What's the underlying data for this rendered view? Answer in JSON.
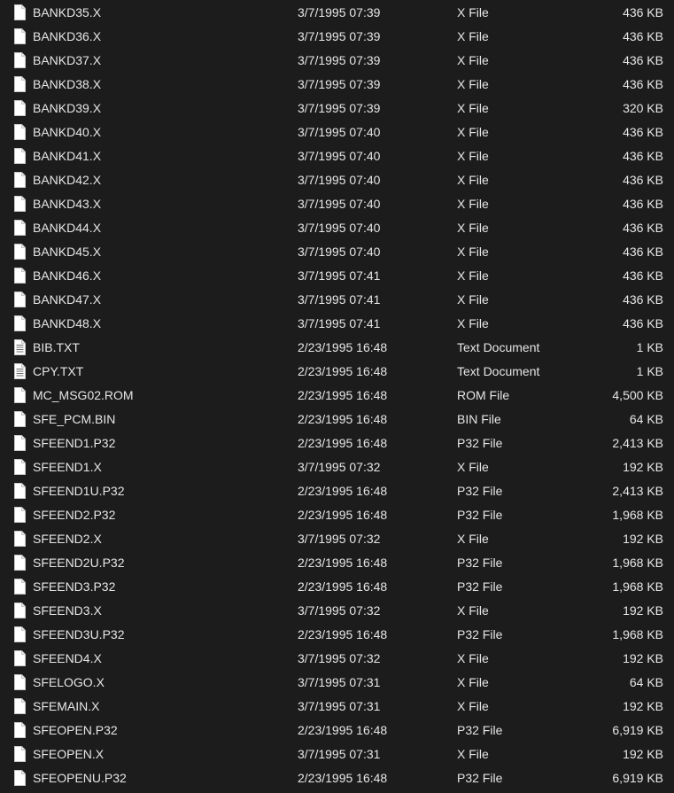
{
  "files": [
    {
      "name": "BANKD35.X",
      "date": "3/7/1995 07:39",
      "type": "X File",
      "size": "436 KB",
      "icon": "file-icon"
    },
    {
      "name": "BANKD36.X",
      "date": "3/7/1995 07:39",
      "type": "X File",
      "size": "436 KB",
      "icon": "file-icon"
    },
    {
      "name": "BANKD37.X",
      "date": "3/7/1995 07:39",
      "type": "X File",
      "size": "436 KB",
      "icon": "file-icon"
    },
    {
      "name": "BANKD38.X",
      "date": "3/7/1995 07:39",
      "type": "X File",
      "size": "436 KB",
      "icon": "file-icon"
    },
    {
      "name": "BANKD39.X",
      "date": "3/7/1995 07:39",
      "type": "X File",
      "size": "320 KB",
      "icon": "file-icon"
    },
    {
      "name": "BANKD40.X",
      "date": "3/7/1995 07:40",
      "type": "X File",
      "size": "436 KB",
      "icon": "file-icon"
    },
    {
      "name": "BANKD41.X",
      "date": "3/7/1995 07:40",
      "type": "X File",
      "size": "436 KB",
      "icon": "file-icon"
    },
    {
      "name": "BANKD42.X",
      "date": "3/7/1995 07:40",
      "type": "X File",
      "size": "436 KB",
      "icon": "file-icon"
    },
    {
      "name": "BANKD43.X",
      "date": "3/7/1995 07:40",
      "type": "X File",
      "size": "436 KB",
      "icon": "file-icon"
    },
    {
      "name": "BANKD44.X",
      "date": "3/7/1995 07:40",
      "type": "X File",
      "size": "436 KB",
      "icon": "file-icon"
    },
    {
      "name": "BANKD45.X",
      "date": "3/7/1995 07:40",
      "type": "X File",
      "size": "436 KB",
      "icon": "file-icon"
    },
    {
      "name": "BANKD46.X",
      "date": "3/7/1995 07:41",
      "type": "X File",
      "size": "436 KB",
      "icon": "file-icon"
    },
    {
      "name": "BANKD47.X",
      "date": "3/7/1995 07:41",
      "type": "X File",
      "size": "436 KB",
      "icon": "file-icon"
    },
    {
      "name": "BANKD48.X",
      "date": "3/7/1995 07:41",
      "type": "X File",
      "size": "436 KB",
      "icon": "file-icon"
    },
    {
      "name": "BIB.TXT",
      "date": "2/23/1995 16:48",
      "type": "Text Document",
      "size": "1 KB",
      "icon": "text-file-icon"
    },
    {
      "name": "CPY.TXT",
      "date": "2/23/1995 16:48",
      "type": "Text Document",
      "size": "1 KB",
      "icon": "text-file-icon"
    },
    {
      "name": "MC_MSG02.ROM",
      "date": "2/23/1995 16:48",
      "type": "ROM File",
      "size": "4,500 KB",
      "icon": "file-icon"
    },
    {
      "name": "SFE_PCM.BIN",
      "date": "2/23/1995 16:48",
      "type": "BIN File",
      "size": "64 KB",
      "icon": "file-icon"
    },
    {
      "name": "SFEEND1.P32",
      "date": "2/23/1995 16:48",
      "type": "P32 File",
      "size": "2,413 KB",
      "icon": "file-icon"
    },
    {
      "name": "SFEEND1.X",
      "date": "3/7/1995 07:32",
      "type": "X File",
      "size": "192 KB",
      "icon": "file-icon"
    },
    {
      "name": "SFEEND1U.P32",
      "date": "2/23/1995 16:48",
      "type": "P32 File",
      "size": "2,413 KB",
      "icon": "file-icon"
    },
    {
      "name": "SFEEND2.P32",
      "date": "2/23/1995 16:48",
      "type": "P32 File",
      "size": "1,968 KB",
      "icon": "file-icon"
    },
    {
      "name": "SFEEND2.X",
      "date": "3/7/1995 07:32",
      "type": "X File",
      "size": "192 KB",
      "icon": "file-icon"
    },
    {
      "name": "SFEEND2U.P32",
      "date": "2/23/1995 16:48",
      "type": "P32 File",
      "size": "1,968 KB",
      "icon": "file-icon"
    },
    {
      "name": "SFEEND3.P32",
      "date": "2/23/1995 16:48",
      "type": "P32 File",
      "size": "1,968 KB",
      "icon": "file-icon"
    },
    {
      "name": "SFEEND3.X",
      "date": "3/7/1995 07:32",
      "type": "X File",
      "size": "192 KB",
      "icon": "file-icon"
    },
    {
      "name": "SFEEND3U.P32",
      "date": "2/23/1995 16:48",
      "type": "P32 File",
      "size": "1,968 KB",
      "icon": "file-icon"
    },
    {
      "name": "SFEEND4.X",
      "date": "3/7/1995 07:32",
      "type": "X File",
      "size": "192 KB",
      "icon": "file-icon"
    },
    {
      "name": "SFELOGO.X",
      "date": "3/7/1995 07:31",
      "type": "X File",
      "size": "64 KB",
      "icon": "file-icon"
    },
    {
      "name": "SFEMAIN.X",
      "date": "3/7/1995 07:31",
      "type": "X File",
      "size": "192 KB",
      "icon": "file-icon"
    },
    {
      "name": "SFEOPEN.P32",
      "date": "2/23/1995 16:48",
      "type": "P32 File",
      "size": "6,919 KB",
      "icon": "file-icon"
    },
    {
      "name": "SFEOPEN.X",
      "date": "3/7/1995 07:31",
      "type": "X File",
      "size": "192 KB",
      "icon": "file-icon"
    },
    {
      "name": "SFEOPENU.P32",
      "date": "2/23/1995 16:48",
      "type": "P32 File",
      "size": "6,919 KB",
      "icon": "file-icon"
    }
  ]
}
